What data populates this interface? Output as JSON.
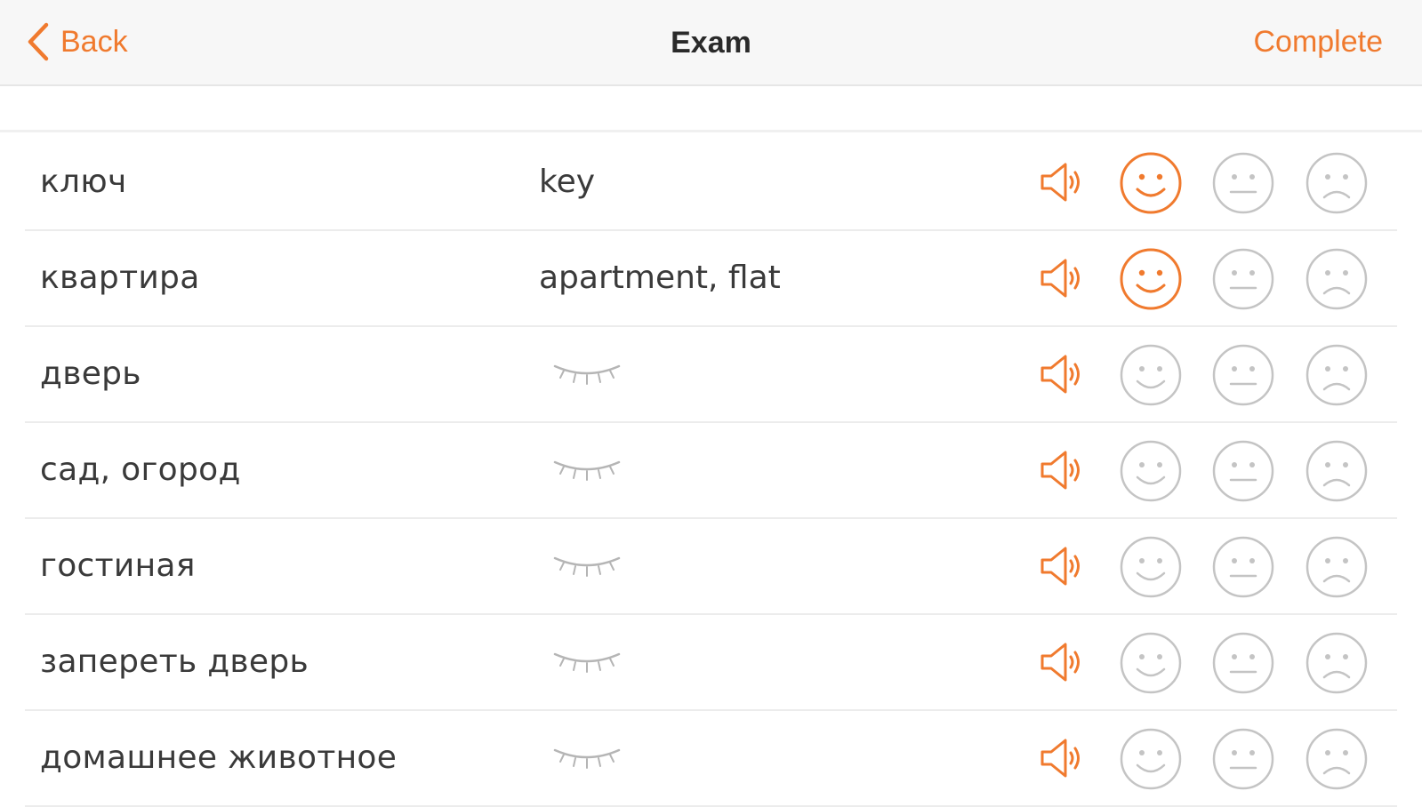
{
  "header": {
    "back_label": "Back",
    "title": "Exam",
    "complete_label": "Complete"
  },
  "colors": {
    "accent": "#f07a2e",
    "inactive_icon": "#c4c4c4",
    "text": "#3a3a3a"
  },
  "rows": [
    {
      "word": "ключ",
      "translation": "key",
      "revealed": true,
      "selected": "good"
    },
    {
      "word": "квартира",
      "translation": "apartment, flat",
      "revealed": true,
      "selected": "good"
    },
    {
      "word": "дверь",
      "translation": "",
      "revealed": false,
      "selected": "none"
    },
    {
      "word": "сад, огород",
      "translation": "",
      "revealed": false,
      "selected": "none"
    },
    {
      "word": "гостиная",
      "translation": "",
      "revealed": false,
      "selected": "none"
    },
    {
      "word": "запереть дверь",
      "translation": "",
      "revealed": false,
      "selected": "none"
    },
    {
      "word": "домашнее животное",
      "translation": "",
      "revealed": false,
      "selected": "none"
    }
  ]
}
